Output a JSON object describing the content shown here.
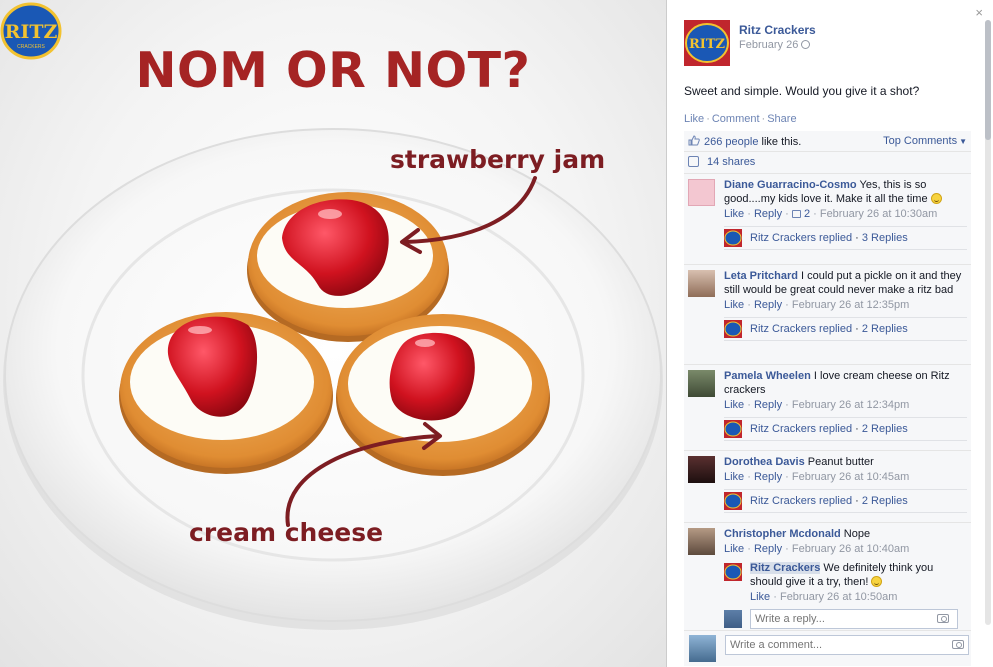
{
  "photo": {
    "headline": "NOM OR NOT?",
    "label_jam": "strawberry jam",
    "label_cheese": "cream cheese",
    "logo_text": "RITZ",
    "logo_subtext": "CRACKERS"
  },
  "post": {
    "page_name": "Ritz Crackers",
    "date": "February 26",
    "text": "Sweet and simple. Would you give it a shot?",
    "actions": {
      "like": "Like",
      "comment": "Comment",
      "share": "Share",
      "separator": "·"
    },
    "likes_link": "266 people",
    "likes_suffix": "like this.",
    "sort_label": "Top Comments",
    "shares": "14 shares",
    "close": "×"
  },
  "comments": [
    {
      "author": "Diane Guarracino-Cosmo",
      "text": "Yes, this is so good....my kids love it. Make it all the time",
      "like": "Like",
      "reply": "Reply",
      "likes_count": "2",
      "timestamp": "February 26 at 10:30am",
      "replied_by": "Ritz Crackers replied",
      "reply_count": "3 Replies"
    },
    {
      "author": "Leta Pritchard",
      "text": "I could put a pickle on it and they still would be great could never make a ritz bad",
      "like": "Like",
      "reply": "Reply",
      "timestamp": "February 26 at 12:35pm",
      "replied_by": "Ritz Crackers replied",
      "reply_count": "2 Replies"
    },
    {
      "author": "Pamela Wheelen",
      "text": "I love cream cheese on Ritz crackers",
      "like": "Like",
      "reply": "Reply",
      "timestamp": "February 26 at 12:34pm",
      "replied_by": "Ritz Crackers replied",
      "reply_count": "2 Replies"
    },
    {
      "author": "Dorothea Davis",
      "text": "Peanut butter",
      "like": "Like",
      "reply": "Reply",
      "timestamp": "February 26 at 10:45am",
      "replied_by": "Ritz Crackers replied",
      "reply_count": "2 Replies"
    },
    {
      "author": "Christopher Mcdonald",
      "text": "Nope",
      "like": "Like",
      "reply": "Reply",
      "timestamp": "February 26 at 10:40am",
      "page_reply": {
        "author": "Ritz Crackers",
        "text": "We definitely think you should give it a try, then!",
        "like": "Like",
        "timestamp": "February 26 at 10:50am"
      },
      "reply_placeholder": "Write a reply..."
    }
  ],
  "comment_placeholder": "Write a comment...",
  "colors": {
    "link": "#3b5998",
    "headline": "#a52424",
    "label": "#7d1d22",
    "panel_bg": "#f6f7f9"
  },
  "icons": [
    "globe-icon",
    "thumbs-up-icon",
    "share-icon",
    "smile-emoticon",
    "camera-icon",
    "close-icon",
    "ritz-logo"
  ]
}
